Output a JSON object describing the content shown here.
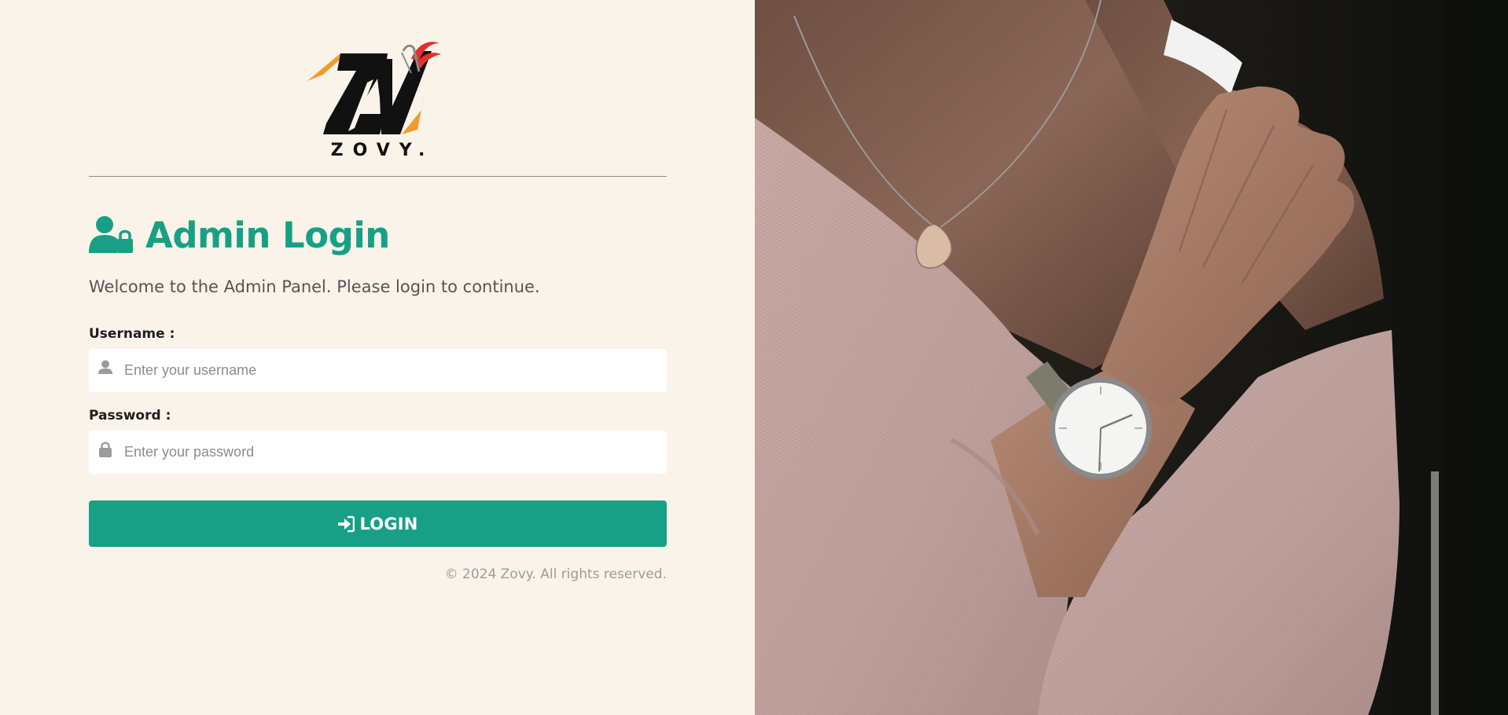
{
  "brand": {
    "name": "ZOVY.",
    "logo_letters": "ZV",
    "colors": {
      "accent": "#17a085",
      "logo_orange": "#f29a2e",
      "logo_red": "#e0312f",
      "logo_black": "#111111"
    }
  },
  "header": {
    "title": "Admin Login",
    "title_icon": "user-lock-icon",
    "subtitle": "Welcome to the Admin Panel. Please login to continue."
  },
  "form": {
    "username": {
      "label": "Username :",
      "placeholder": "Enter your username",
      "value": "",
      "icon": "user-icon"
    },
    "password": {
      "label": "Password :",
      "placeholder": "Enter your password",
      "value": "",
      "icon": "lock-icon"
    },
    "submit": {
      "label": "LOGIN",
      "icon": "sign-in-icon"
    }
  },
  "footer": {
    "copyright": "© 2024 Zovy. All rights reserved."
  },
  "hero_image": {
    "description_icon": "photo-model-watch"
  },
  "colors": {
    "left_background": "#faf3e9",
    "input_background": "#ffffff",
    "placeholder": "#8c8c8c",
    "sweater": "#c9aaa6",
    "photo_background": "#121310"
  }
}
